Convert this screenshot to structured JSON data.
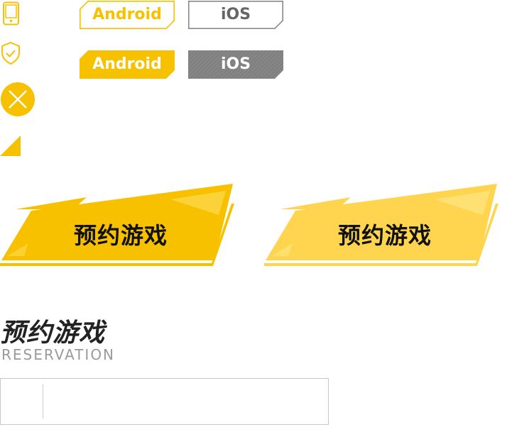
{
  "colors": {
    "accent": "#F7C100",
    "accent_light": "#FFD550",
    "ios_gray": "#808080"
  },
  "icons": {
    "phone": "phone-icon",
    "shield": "shield-check-icon",
    "close": "close-circle-icon",
    "corner": "corner-triangle-icon"
  },
  "platform_tags": {
    "android_outline": "Android",
    "ios_outline": "iOS",
    "android_filled": "Android",
    "ios_filled": "iOS"
  },
  "buttons": {
    "reserve_primary": "预约游戏",
    "reserve_hover": "预约游戏"
  },
  "section": {
    "title": "预约游戏",
    "subtitle": "RESERVATION"
  }
}
